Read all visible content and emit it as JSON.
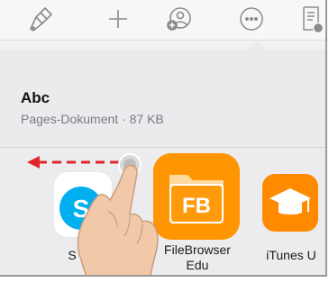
{
  "toolbar": {
    "icons": [
      "paintbrush-icon",
      "plus-icon",
      "add-person-icon",
      "more-icon",
      "document-view-icon"
    ]
  },
  "document": {
    "title": "Abc",
    "meta": "Pages-Dokument · 87 KB"
  },
  "apps": [
    {
      "name": "Skype",
      "visible_label": "S",
      "color": "#00aff0"
    },
    {
      "name": "FileBrowser Edu",
      "line1": "FileBrowser",
      "line2": "Edu",
      "badge": "FB",
      "color": "#ff9500"
    },
    {
      "name": "iTunes U",
      "label": "iTunes U",
      "color": "#ff8a00"
    }
  ],
  "colors": {
    "accent_arrow": "#e0262b",
    "toolbar_icon": "#8b8b8f"
  }
}
